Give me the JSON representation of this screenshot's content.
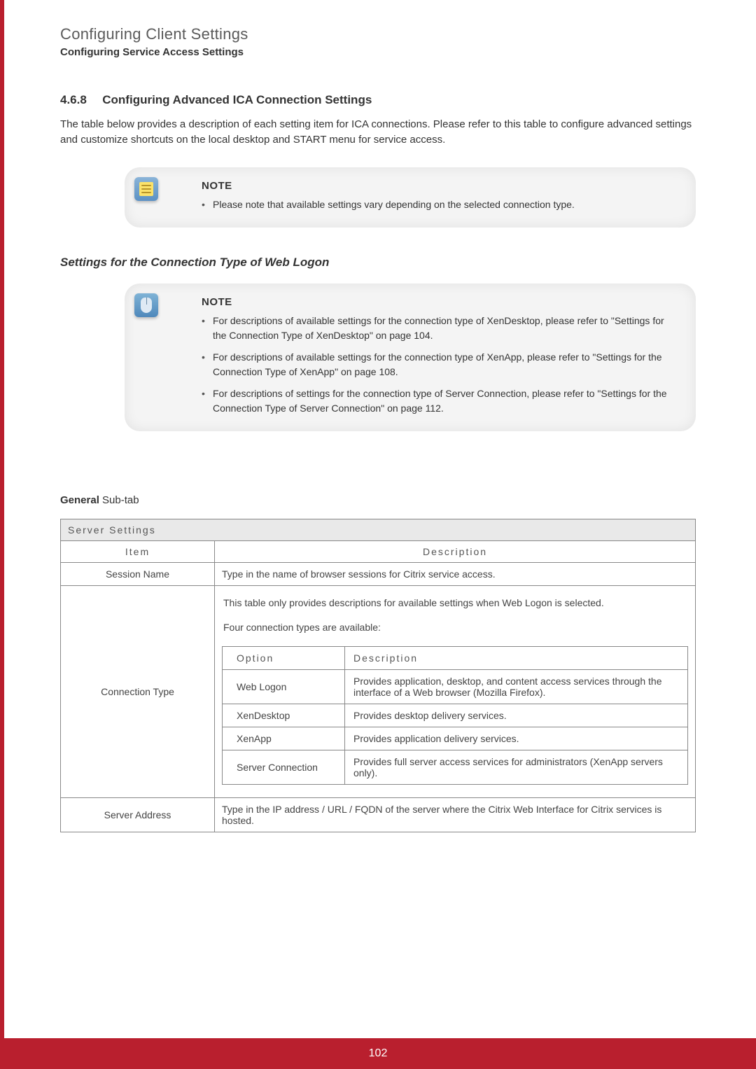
{
  "header": {
    "title": "Configuring Client Settings",
    "subtitle": "Configuring Service Access Settings"
  },
  "section": {
    "number": "4.6.8",
    "title": "Configuring Advanced ICA Connection Settings",
    "intro": "The table below provides a description of each setting item for ICA connections. Please refer to this table to configure advanced settings and customize shortcuts on the local desktop and START menu for service access."
  },
  "note1": {
    "label": "NOTE",
    "items": [
      "Please note that available settings vary depending on the selected connection type."
    ]
  },
  "subhead": "Settings for the Connection Type of Web Logon",
  "note2": {
    "label": "NOTE",
    "items": [
      "For descriptions of available settings for the connection type of XenDesktop, please refer to \"Settings for the Connection Type of XenDesktop\" on page 104.",
      "For descriptions of available settings for the connection type of XenApp, please refer to \"Settings for the Connection Type of XenApp\" on page 108.",
      "For descriptions of settings for the connection type of Server Connection, please refer to \"Settings for the Connection Type of Server Connection\" on page 112."
    ]
  },
  "subtab": {
    "bold": "General",
    "rest": " Sub-tab"
  },
  "table": {
    "section_header": "Server Settings",
    "col_item": "Item",
    "col_desc": "Description",
    "rows": {
      "session_name": {
        "item": "Session Name",
        "desc": "Type in the name of browser sessions for Citrix service access."
      },
      "connection_type": {
        "item": "Connection Type",
        "intro1": "This table only provides descriptions for available settings when Web Logon is selected.",
        "intro2": "Four connection types are available:",
        "inner_head_option": "Option",
        "inner_head_desc": "Description",
        "options": [
          {
            "name": "Web Logon",
            "desc": "Provides application, desktop, and content access services through the interface of a Web browser (Mozilla Firefox)."
          },
          {
            "name": "XenDesktop",
            "desc": "Provides desktop delivery services."
          },
          {
            "name": "XenApp",
            "desc": "Provides application delivery services."
          },
          {
            "name": "Server Connection",
            "desc": "Provides full server access services for administrators (XenApp servers only)."
          }
        ]
      },
      "server_address": {
        "item": "Server Address",
        "desc": "Type in the IP address / URL / FQDN of the server where the Citrix Web Interface for Citrix services is hosted."
      }
    }
  },
  "page_number": "102"
}
